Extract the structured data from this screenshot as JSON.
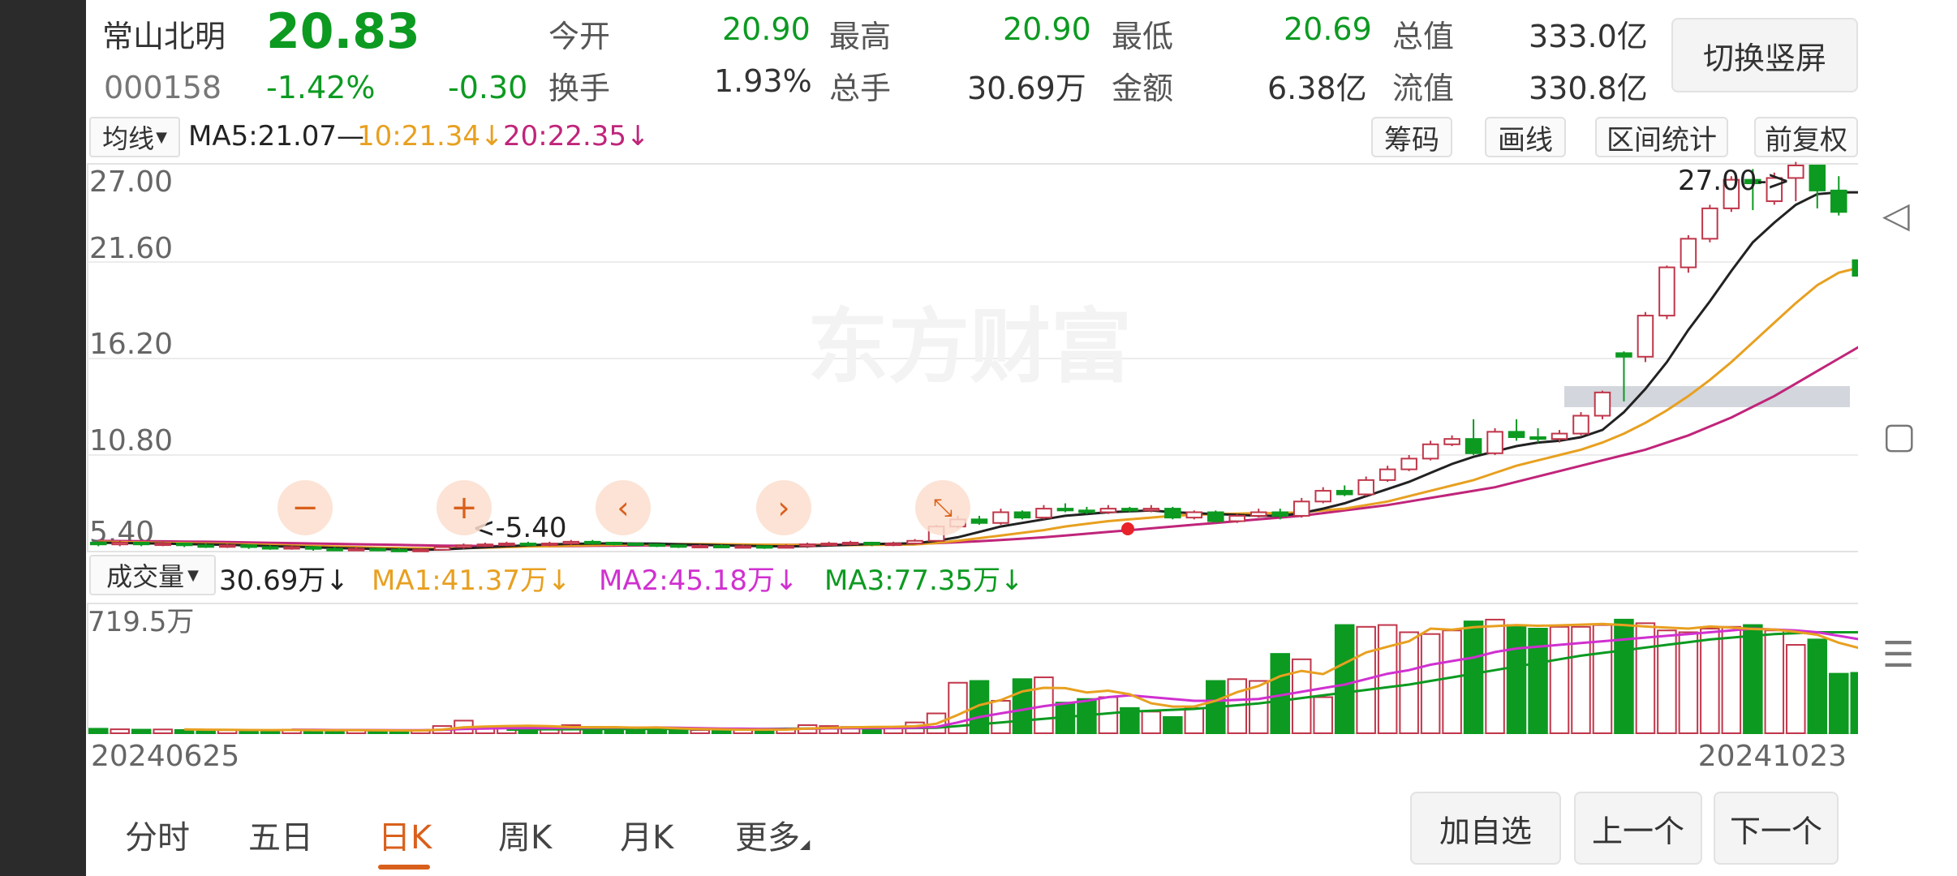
{
  "stock": {
    "name": "常山北明",
    "price": "20.83",
    "code": "000158",
    "change_pct": "-1.42%",
    "change_amt": "-0.30"
  },
  "quote": {
    "open_label": "今开",
    "open": "20.90",
    "high_label": "最高",
    "high": "20.90",
    "low_label": "最低",
    "low": "20.69",
    "mktcap_label": "总值",
    "mktcap": "333.0亿",
    "turnover_label": "换手",
    "turnover": "1.93%",
    "volume_label": "总手",
    "volume": "30.69万",
    "amount_label": "金额",
    "amount": "6.38亿",
    "float_label": "流值",
    "float": "330.8亿"
  },
  "buttons": {
    "switch": "切换竖屏",
    "chips": "筹码",
    "draw": "画线",
    "interval": "区间统计",
    "adjust": "前复权",
    "add_watch": "加自选",
    "prev": "上一个",
    "next": "下一个"
  },
  "ma_bar": {
    "selector": "均线",
    "ma5": "MA5:21.07—",
    "ma10": "10:21.34↓",
    "ma20": "20:22.35↓"
  },
  "vol_bar": {
    "selector": "成交量",
    "value": "30.69万↓",
    "ma1": "MA1:41.37万↓",
    "ma2": "MA2:45.18万↓",
    "ma3": "MA3:77.35万↓"
  },
  "watermark": "东方财富",
  "tabs": [
    {
      "label": "分时"
    },
    {
      "label": "五日"
    },
    {
      "label": "日K"
    },
    {
      "label": "周K"
    },
    {
      "label": "月K"
    },
    {
      "label": "更多"
    }
  ],
  "colors": {
    "up": "#c0364a",
    "down": "#0c9a21",
    "ma5": "#222222",
    "ma10": "#e8a020",
    "ma20": "#c0257a",
    "vol_ma1": "#e8a020",
    "vol_ma2": "#d030d0",
    "vol_ma3": "#0c9a21",
    "accent": "#d9601c"
  },
  "chart_data": {
    "type": "candlestick",
    "date_start": "20240625",
    "date_end": "20241023",
    "price_ticks": [
      "27.00",
      "21.60",
      "16.20",
      "10.80",
      "5.40"
    ],
    "ylim": [
      5.4,
      27.0
    ],
    "max_label": "27.00->",
    "min_label": "<-5.40",
    "volume_max_label": "719.5万",
    "volume_ylim_wan": [
      0,
      719.5
    ],
    "candles": [
      [
        5.9,
        5.8,
        5.95,
        5.7
      ],
      [
        5.8,
        5.9,
        6.0,
        5.7
      ],
      [
        5.9,
        5.8,
        5.95,
        5.7
      ],
      [
        5.8,
        5.85,
        5.95,
        5.7
      ],
      [
        5.85,
        5.75,
        5.9,
        5.65
      ],
      [
        5.75,
        5.7,
        5.85,
        5.6
      ],
      [
        5.7,
        5.75,
        5.85,
        5.6
      ],
      [
        5.75,
        5.65,
        5.8,
        5.55
      ],
      [
        5.65,
        5.6,
        5.75,
        5.5
      ],
      [
        5.6,
        5.65,
        5.75,
        5.5
      ],
      [
        5.65,
        5.55,
        5.7,
        5.45
      ],
      [
        5.55,
        5.5,
        5.65,
        5.45
      ],
      [
        5.5,
        5.55,
        5.65,
        5.45
      ],
      [
        5.55,
        5.5,
        5.6,
        5.42
      ],
      [
        5.5,
        5.45,
        5.6,
        5.4
      ],
      [
        5.45,
        5.5,
        5.6,
        5.4
      ],
      [
        5.5,
        5.65,
        5.75,
        5.45
      ],
      [
        5.65,
        5.75,
        5.85,
        5.55
      ],
      [
        5.75,
        5.8,
        5.9,
        5.65
      ],
      [
        5.8,
        5.85,
        5.95,
        5.7
      ],
      [
        5.85,
        5.8,
        5.95,
        5.7
      ],
      [
        5.8,
        5.85,
        5.95,
        5.7
      ],
      [
        5.85,
        5.95,
        6.05,
        5.75
      ],
      [
        5.95,
        5.9,
        6.05,
        5.8
      ],
      [
        5.9,
        5.85,
        5.95,
        5.75
      ],
      [
        5.85,
        5.8,
        5.9,
        5.7
      ],
      [
        5.8,
        5.75,
        5.85,
        5.65
      ],
      [
        5.75,
        5.7,
        5.8,
        5.6
      ],
      [
        5.7,
        5.72,
        5.8,
        5.6
      ],
      [
        5.72,
        5.68,
        5.8,
        5.6
      ],
      [
        5.68,
        5.7,
        5.8,
        5.6
      ],
      [
        5.7,
        5.65,
        5.75,
        5.55
      ],
      [
        5.65,
        5.7,
        5.8,
        5.6
      ],
      [
        5.7,
        5.8,
        5.9,
        5.6
      ],
      [
        5.8,
        5.85,
        5.95,
        5.7
      ],
      [
        5.85,
        5.9,
        6.0,
        5.75
      ],
      [
        5.9,
        5.8,
        5.95,
        5.7
      ],
      [
        5.8,
        5.85,
        5.95,
        5.7
      ],
      [
        5.85,
        6.0,
        6.1,
        5.8
      ],
      [
        6.0,
        6.8,
        6.9,
        5.95
      ],
      [
        6.8,
        7.2,
        7.4,
        6.7
      ],
      [
        7.2,
        7.0,
        7.4,
        6.9
      ],
      [
        7.0,
        7.6,
        7.8,
        6.9
      ],
      [
        7.6,
        7.3,
        7.7,
        7.2
      ],
      [
        7.3,
        7.8,
        8.0,
        7.2
      ],
      [
        7.8,
        7.7,
        8.1,
        7.6
      ],
      [
        7.7,
        7.6,
        7.9,
        7.5
      ],
      [
        7.6,
        7.8,
        8.0,
        7.5
      ],
      [
        7.8,
        7.7,
        7.9,
        7.6
      ],
      [
        7.7,
        7.8,
        8.0,
        7.6
      ],
      [
        7.8,
        7.3,
        7.9,
        7.2
      ],
      [
        7.3,
        7.6,
        7.7,
        7.2
      ],
      [
        7.6,
        7.1,
        7.7,
        7.0
      ],
      [
        7.1,
        7.4,
        7.5,
        7.0
      ],
      [
        7.4,
        7.6,
        7.8,
        7.3
      ],
      [
        7.6,
        7.4,
        7.8,
        7.2
      ],
      [
        7.4,
        8.2,
        8.4,
        7.3
      ],
      [
        8.2,
        8.8,
        9.0,
        8.1
      ],
      [
        8.8,
        8.6,
        9.1,
        8.5
      ],
      [
        8.6,
        9.4,
        9.6,
        8.5
      ],
      [
        9.4,
        10.0,
        10.2,
        9.3
      ],
      [
        10.0,
        10.6,
        10.8,
        9.9
      ],
      [
        10.6,
        11.4,
        11.6,
        10.5
      ],
      [
        11.4,
        11.7,
        11.9,
        11.3
      ],
      [
        11.7,
        10.9,
        12.8,
        10.8
      ],
      [
        10.9,
        12.1,
        12.3,
        10.8
      ],
      [
        12.1,
        11.8,
        12.8,
        11.6
      ],
      [
        11.8,
        11.7,
        12.3,
        11.5
      ],
      [
        11.7,
        12.0,
        12.2,
        11.5
      ],
      [
        12.0,
        13.0,
        13.2,
        11.9
      ],
      [
        13.0,
        14.3,
        14.4,
        12.8
      ],
      [
        16.5,
        16.3,
        16.6,
        13.8
      ],
      [
        16.3,
        18.6,
        18.8,
        16.0
      ],
      [
        18.6,
        21.3,
        21.4,
        18.4
      ],
      [
        21.3,
        22.9,
        23.1,
        21.0
      ],
      [
        22.9,
        24.6,
        24.8,
        22.7
      ],
      [
        24.6,
        26.2,
        26.4,
        24.4
      ],
      [
        26.2,
        26.0,
        26.8,
        24.5
      ],
      [
        25.0,
        26.3,
        26.6,
        24.8
      ],
      [
        26.3,
        27.0,
        27.2,
        25.0
      ],
      [
        27.0,
        25.6,
        27.0,
        24.6
      ],
      [
        25.6,
        24.4,
        26.4,
        24.2
      ],
      [
        21.7,
        20.83,
        21.9,
        20.69
      ]
    ],
    "ma5": [
      5.9,
      5.88,
      5.86,
      5.85,
      5.82,
      5.8,
      5.78,
      5.74,
      5.7,
      5.67,
      5.64,
      5.6,
      5.57,
      5.55,
      5.52,
      5.5,
      5.52,
      5.58,
      5.64,
      5.7,
      5.75,
      5.8,
      5.83,
      5.85,
      5.86,
      5.85,
      5.84,
      5.81,
      5.78,
      5.75,
      5.72,
      5.7,
      5.69,
      5.7,
      5.74,
      5.78,
      5.82,
      5.84,
      5.86,
      6.0,
      6.2,
      6.5,
      6.8,
      7.0,
      7.2,
      7.4,
      7.5,
      7.6,
      7.65,
      7.7,
      7.6,
      7.55,
      7.5,
      7.45,
      7.4,
      7.4,
      7.55,
      7.8,
      8.1,
      8.5,
      8.9,
      9.3,
      9.8,
      10.3,
      10.7,
      11.0,
      11.3,
      11.5,
      11.6,
      11.8,
      12.2,
      13.2,
      14.5,
      16.0,
      17.8,
      19.4,
      21.1,
      22.7,
      23.8,
      24.8,
      25.4,
      25.5,
      25.5
    ],
    "ma10": [
      5.95,
      5.93,
      5.91,
      5.89,
      5.87,
      5.85,
      5.83,
      5.8,
      5.77,
      5.74,
      5.71,
      5.68,
      5.65,
      5.62,
      5.6,
      5.58,
      5.58,
      5.6,
      5.62,
      5.65,
      5.68,
      5.7,
      5.73,
      5.76,
      5.78,
      5.8,
      5.81,
      5.82,
      5.82,
      5.81,
      5.8,
      5.78,
      5.77,
      5.76,
      5.76,
      5.76,
      5.77,
      5.78,
      5.8,
      5.88,
      6.0,
      6.15,
      6.3,
      6.45,
      6.6,
      6.8,
      6.95,
      7.1,
      7.2,
      7.3,
      7.4,
      7.45,
      7.5,
      7.52,
      7.55,
      7.55,
      7.6,
      7.7,
      7.8,
      8.0,
      8.2,
      8.5,
      8.8,
      9.1,
      9.4,
      9.8,
      10.2,
      10.5,
      10.8,
      11.1,
      11.5,
      12.0,
      12.6,
      13.3,
      14.1,
      15.0,
      16.0,
      17.1,
      18.2,
      19.3,
      20.3,
      21.0,
      21.3
    ],
    "ma20": [
      6.0,
      5.99,
      5.98,
      5.97,
      5.96,
      5.95,
      5.93,
      5.91,
      5.89,
      5.87,
      5.85,
      5.83,
      5.81,
      5.79,
      5.77,
      5.75,
      5.73,
      5.72,
      5.71,
      5.7,
      5.7,
      5.7,
      5.71,
      5.72,
      5.73,
      5.74,
      5.75,
      5.75,
      5.76,
      5.76,
      5.77,
      5.77,
      5.77,
      5.78,
      5.78,
      5.79,
      5.8,
      5.82,
      5.84,
      5.87,
      5.92,
      5.98,
      6.05,
      6.12,
      6.2,
      6.3,
      6.4,
      6.5,
      6.6,
      6.7,
      6.8,
      6.9,
      7.0,
      7.1,
      7.2,
      7.3,
      7.4,
      7.55,
      7.7,
      7.85,
      8.0,
      8.2,
      8.4,
      8.6,
      8.8,
      9.0,
      9.3,
      9.6,
      9.9,
      10.2,
      10.5,
      10.8,
      11.1,
      11.5,
      11.9,
      12.4,
      12.9,
      13.5,
      14.1,
      14.8,
      15.5,
      16.2,
      16.9
    ],
    "volume_wan": [
      25,
      22,
      20,
      21,
      18,
      19,
      17,
      16,
      18,
      20,
      15,
      14,
      16,
      15,
      17,
      14,
      40,
      70,
      35,
      30,
      32,
      28,
      45,
      35,
      28,
      30,
      22,
      20,
      18,
      21,
      19,
      20,
      24,
      45,
      40,
      35,
      30,
      28,
      60,
      110,
      280,
      290,
      180,
      300,
      310,
      170,
      190,
      200,
      140,
      120,
      90,
      140,
      290,
      300,
      290,
      440,
      410,
      200,
      600,
      590,
      600,
      560,
      550,
      570,
      620,
      630,
      600,
      580,
      590,
      590,
      600,
      630,
      610,
      570,
      560,
      580,
      590,
      600,
      570,
      490,
      520,
      330,
      335
    ],
    "vol_ma1": [
      null,
      null,
      null,
      null,
      21,
      20,
      19,
      18,
      17.5,
      18,
      17.2,
      16.6,
      16.6,
      16,
      15.4,
      15.2,
      20.4,
      32.4,
      37.2,
      40,
      41.4,
      39,
      34,
      33.4,
      33.6,
      31.2,
      32,
      27,
      23.6,
      22.2,
      20,
      19.6,
      20.4,
      25.8,
      29.6,
      32.6,
      34.8,
      35.6,
      38.6,
      52.6,
      101.6,
      155.6,
      184,
      232,
      252,
      250,
      226,
      236,
      216,
      166,
      148,
      148,
      180,
      228,
      262,
      316,
      346,
      328,
      388,
      448,
      480,
      510,
      580,
      574,
      588,
      594,
      600,
      596,
      598,
      602,
      606,
      600,
      592,
      586,
      580,
      592,
      586,
      578,
      575,
      562,
      546,
      502,
      471
    ],
    "vol_ma2": [
      null,
      null,
      null,
      null,
      null,
      null,
      null,
      null,
      null,
      20,
      19,
      18,
      18,
      17.5,
      17,
      16.5,
      19,
      24,
      26,
      28,
      29,
      29,
      30,
      31,
      31.5,
      31,
      32,
      30,
      28,
      26,
      25,
      24,
      23,
      25,
      27,
      28,
      29,
      29,
      30,
      35,
      60,
      90,
      110,
      130,
      150,
      165,
      180,
      200,
      210,
      200,
      190,
      180,
      180,
      185,
      190,
      210,
      230,
      250,
      270,
      300,
      330,
      350,
      380,
      400,
      420,
      450,
      470,
      480,
      490,
      500,
      510,
      520,
      530,
      540,
      550,
      560,
      570,
      580,
      575,
      570,
      560,
      540,
      520
    ],
    "vol_ma3": [
      null,
      null,
      null,
      null,
      null,
      null,
      null,
      null,
      null,
      null,
      null,
      null,
      null,
      null,
      null,
      null,
      null,
      null,
      null,
      20,
      21,
      22,
      22,
      23,
      23,
      24,
      24,
      24,
      24,
      24,
      24,
      24,
      25,
      26,
      27,
      28,
      28,
      29,
      29,
      30,
      40,
      50,
      60,
      70,
      80,
      90,
      100,
      110,
      120,
      125,
      130,
      135,
      145,
      155,
      165,
      180,
      195,
      210,
      225,
      240,
      255,
      270,
      290,
      310,
      330,
      350,
      370,
      390,
      410,
      430,
      445,
      460,
      475,
      490,
      505,
      520,
      530,
      540,
      550,
      555,
      560,
      560,
      560
    ]
  }
}
